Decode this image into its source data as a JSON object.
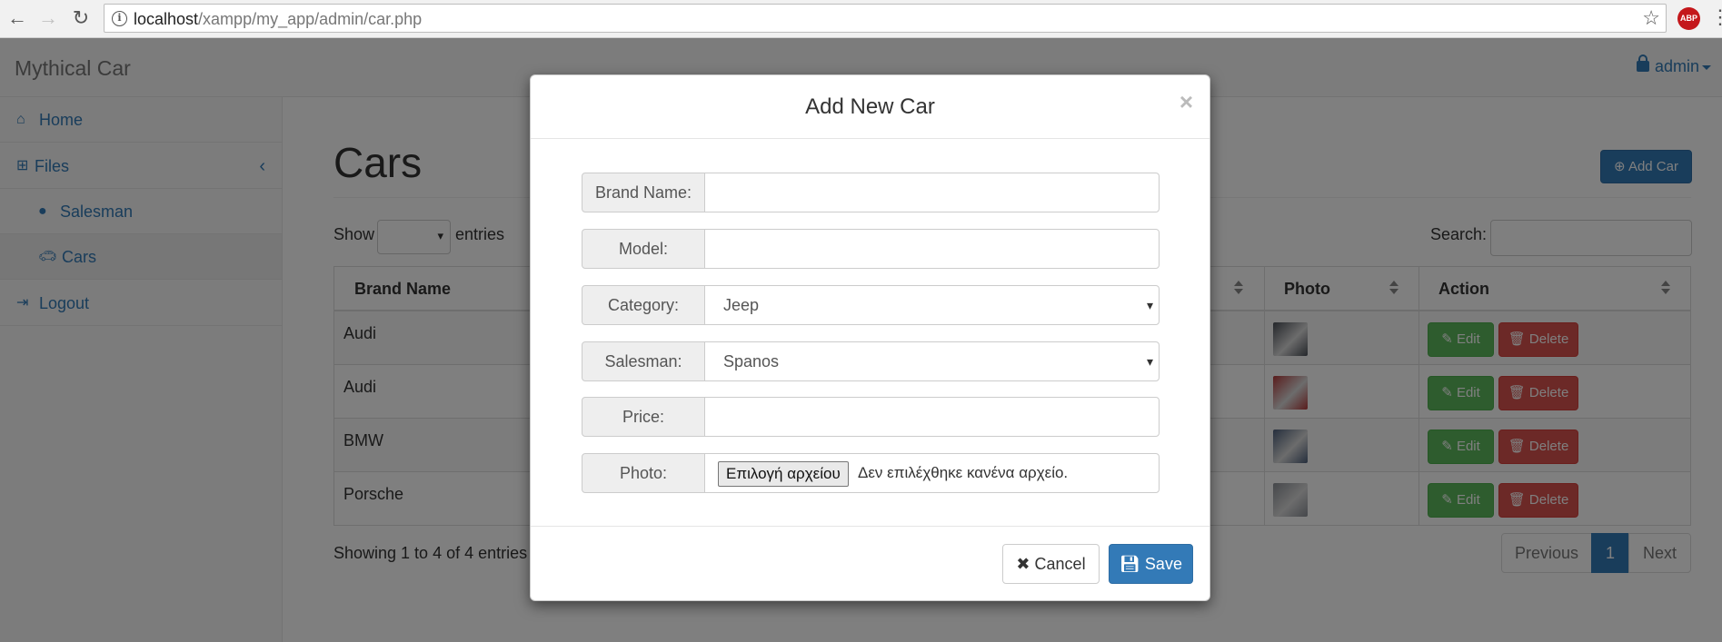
{
  "browser": {
    "url_host": "localhost",
    "url_path": "/xampp/my_app/admin/car.php",
    "abp_label": "ABP"
  },
  "navbar": {
    "brand": "Mythical Car",
    "user": "admin"
  },
  "sidebar": {
    "items": [
      {
        "label": "Home"
      },
      {
        "label": "Files"
      },
      {
        "label": "Salesman"
      },
      {
        "label": "Cars"
      },
      {
        "label": "Logout"
      }
    ]
  },
  "main": {
    "title": "Cars",
    "add_button": "Add Car",
    "show_label": "Show",
    "entries_label": "entries",
    "search_label": "Search:",
    "columns": {
      "brand": "Brand Name",
      "photo": "Photo",
      "action": "Action"
    },
    "rows": [
      {
        "brand": "Audi",
        "photo_color": "#4a4f57"
      },
      {
        "brand": "Audi",
        "photo_color": "#b33a3a"
      },
      {
        "brand": "BMW",
        "photo_color": "#4c5e7a"
      },
      {
        "brand": "Porsche",
        "photo_color": "#8b8f96"
      }
    ],
    "edit_label": "Edit",
    "delete_label": "Delete",
    "showing": "Showing 1 to 4 of 4 entries",
    "pager": {
      "previous": "Previous",
      "page": "1",
      "next": "Next"
    }
  },
  "modal": {
    "title": "Add New Car",
    "close": "×",
    "fields": {
      "brand_label": "Brand Name:",
      "brand_value": "",
      "model_label": "Model:",
      "model_value": "",
      "category_label": "Category:",
      "category_value": "Jeep",
      "salesman_label": "Salesman:",
      "salesman_value": "Spanos",
      "price_label": "Price:",
      "price_value": "",
      "photo_label": "Photo:",
      "file_button": "Επιλογή αρχείου",
      "file_status": "Δεν επιλέχθηκε κανένα αρχείο."
    },
    "cancel": "Cancel",
    "save": "Save"
  },
  "colors": {
    "primary": "#337ab7",
    "success": "#5cb85c",
    "danger": "#d9534f"
  }
}
